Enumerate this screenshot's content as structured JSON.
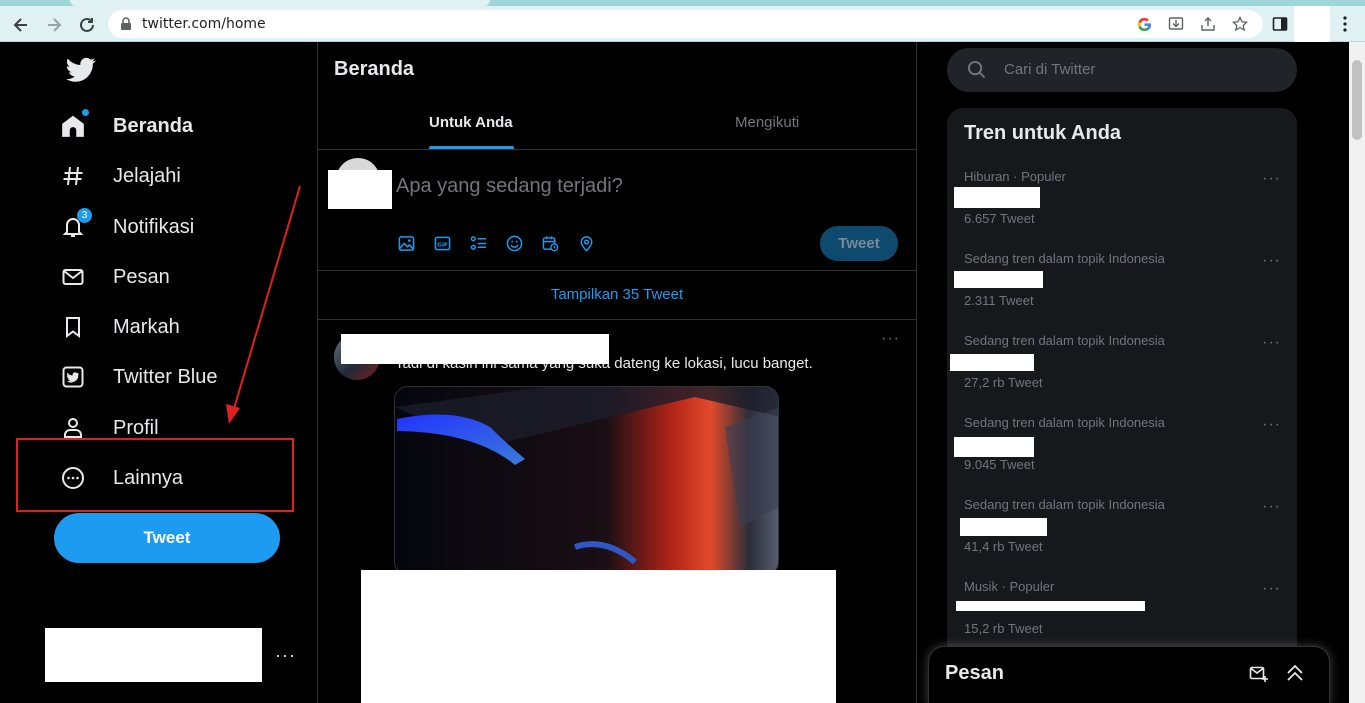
{
  "browser": {
    "url": "twitter.com/home"
  },
  "sidebar": {
    "items": [
      {
        "label": "Beranda",
        "icon": "home-icon"
      },
      {
        "label": "Jelajahi",
        "icon": "hashtag-icon"
      },
      {
        "label": "Notifikasi",
        "icon": "bell-icon",
        "badge": "3"
      },
      {
        "label": "Pesan",
        "icon": "mail-icon"
      },
      {
        "label": "Markah",
        "icon": "bookmark-icon"
      },
      {
        "label": "Twitter Blue",
        "icon": "twitter-blue-icon"
      },
      {
        "label": "Profil",
        "icon": "person-icon"
      },
      {
        "label": "Lainnya",
        "icon": "more-circle-icon"
      }
    ],
    "tweet_button": "Tweet"
  },
  "main": {
    "title": "Beranda",
    "tabs": [
      {
        "label": "Untuk Anda",
        "active": true
      },
      {
        "label": "Mengikuti",
        "active": false
      }
    ],
    "compose": {
      "placeholder": "Apa yang sedang terjadi?",
      "tweet_button": "Tweet"
    },
    "show_more": "Tampilkan 35 Tweet",
    "tweet": {
      "text": "Tadi di kasih ini sama yang suka dateng ke lokasi, lucu banget."
    }
  },
  "right": {
    "search_placeholder": "Cari di Twitter",
    "trends_title": "Tren untuk Anda",
    "trends": [
      {
        "context": "Hiburan · Populer",
        "count": "6.657 Tweet"
      },
      {
        "context": "Sedang tren dalam topik Indonesia",
        "count": "2.311 Tweet"
      },
      {
        "context": "Sedang tren dalam topik Indonesia",
        "count": "27,2 rb Tweet"
      },
      {
        "context": "Sedang tren dalam topik Indonesia",
        "count": "9.045 Tweet"
      },
      {
        "context": "Sedang tren dalam topik Indonesia",
        "count": "41,4 rb Tweet"
      },
      {
        "context": "Musik · Populer",
        "count": "15,2 rb Tweet"
      }
    ],
    "messages_title": "Pesan"
  },
  "colors": {
    "accent": "#1d9bf0",
    "background": "#000000",
    "highlight": "#e02020"
  }
}
